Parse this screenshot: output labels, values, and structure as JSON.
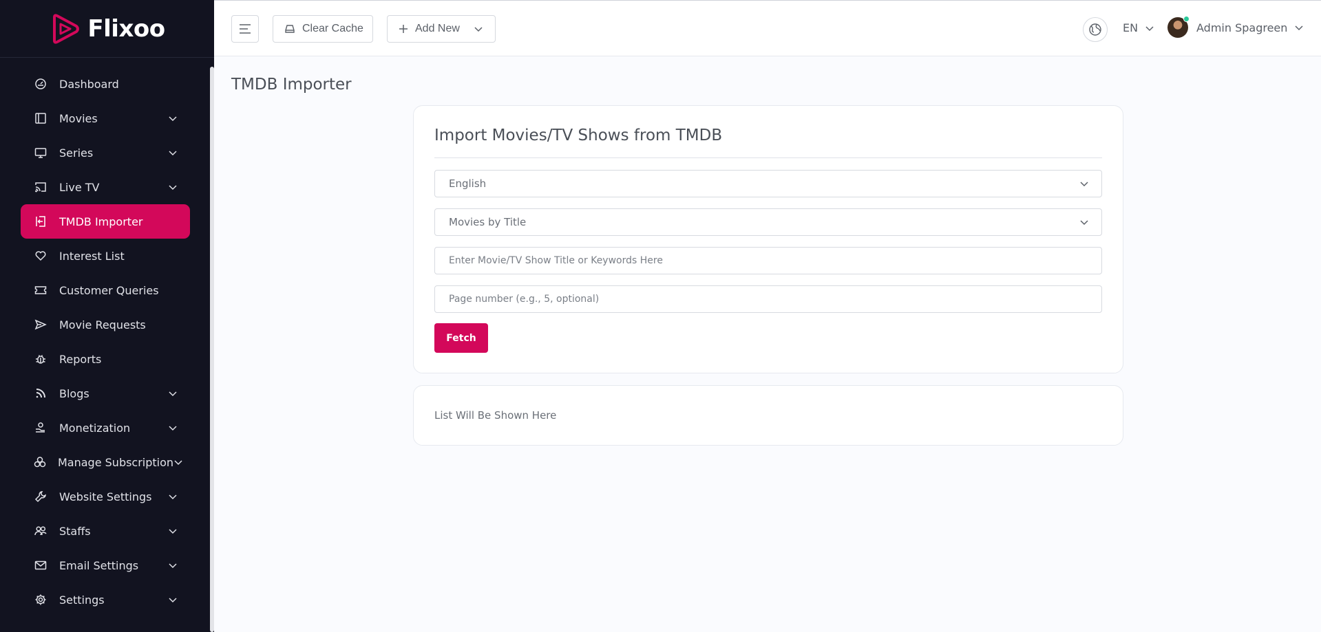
{
  "brand": {
    "name": "Flixoo",
    "accent": "#d3085a"
  },
  "sidebar": {
    "items": [
      {
        "label": "Dashboard",
        "icon": "dashboard-gauge-icon",
        "chevron": false,
        "active": false
      },
      {
        "label": "Movies",
        "icon": "film-icon",
        "chevron": true,
        "active": false
      },
      {
        "label": "Series",
        "icon": "monitor-icon",
        "chevron": true,
        "active": false
      },
      {
        "label": "Live TV",
        "icon": "cast-icon",
        "chevron": true,
        "active": false
      },
      {
        "label": "TMDB Importer",
        "icon": "import-icon",
        "chevron": false,
        "active": true
      },
      {
        "label": "Interest List",
        "icon": "heart-icon",
        "chevron": false,
        "active": false
      },
      {
        "label": "Customer Queries",
        "icon": "ticket-icon",
        "chevron": false,
        "active": false
      },
      {
        "label": "Movie Requests",
        "icon": "send-icon",
        "chevron": false,
        "active": false
      },
      {
        "label": "Reports",
        "icon": "bug-icon",
        "chevron": false,
        "active": false
      },
      {
        "label": "Blogs",
        "icon": "rss-icon",
        "chevron": true,
        "active": false
      },
      {
        "label": "Monetization",
        "icon": "coin-hand-icon",
        "chevron": true,
        "active": false
      },
      {
        "label": "Manage Subscription",
        "icon": "coins-icon",
        "chevron": true,
        "active": false
      },
      {
        "label": "Website Settings",
        "icon": "wrench-icon",
        "chevron": true,
        "active": false
      },
      {
        "label": "Staffs",
        "icon": "users-icon",
        "chevron": true,
        "active": false
      },
      {
        "label": "Email Settings",
        "icon": "mail-icon",
        "chevron": true,
        "active": false
      },
      {
        "label": "Settings",
        "icon": "gear-icon",
        "chevron": true,
        "active": false
      }
    ]
  },
  "topbar": {
    "clear_cache": "Clear Cache",
    "add_new": "Add New",
    "language": "EN",
    "user_name": "Admin Spagreen",
    "online_color": "#2cc99a"
  },
  "page": {
    "title": "TMDB Importer",
    "card_title": "Import Movies/TV Shows from TMDB",
    "language_select": "English",
    "type_select": "Movies by Title",
    "keyword_placeholder": "Enter Movie/TV Show Title or Keywords Here",
    "page_placeholder": "Page number (e.g., 5, optional)",
    "fetch_label": "Fetch",
    "list_placeholder": "List Will Be Shown Here"
  }
}
